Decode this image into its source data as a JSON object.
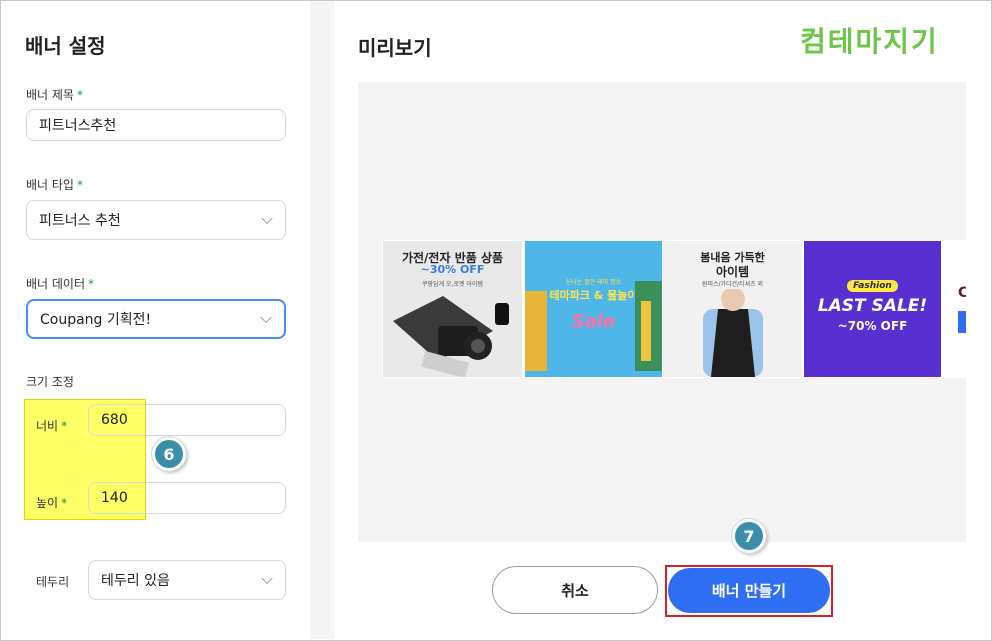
{
  "left": {
    "title": "배너 설정",
    "banner_name": {
      "label": "배너 제목",
      "value": "피트너스추천"
    },
    "banner_type": {
      "label": "배너 타입",
      "value": "피트너스 추천"
    },
    "banner_data": {
      "label": "배너 데이터",
      "value": "Coupang 기획전!"
    },
    "resize": {
      "label": "크기 조정",
      "width_label": "너비",
      "width_value": "680",
      "height_label": "높이",
      "height_value": "140"
    },
    "border": {
      "label": "테두리",
      "value": "테두리 있음"
    },
    "required_mark": "*",
    "step_badge": "6"
  },
  "right": {
    "title": "미리보기",
    "logo": "컴테마지기",
    "step_badge": "7",
    "banners": [
      {
        "headline": "가전/전자 반품 상품",
        "sub": "~30% OFF",
        "note": "쿠팡답게 오,로켓 아이템"
      },
      {
        "headline": "테마파크 & 물놀이",
        "sub": "Sale",
        "note": "신나는 할인 테마 명소"
      },
      {
        "headline": "봄내음 가득한",
        "sub": "아이템",
        "note": "원피스/가디건/티셔츠 외"
      },
      {
        "headline": "LAST SALE!",
        "sub": "~70% OFF",
        "note": "Fashion"
      }
    ],
    "cancel_label": "취소",
    "create_label": "배너 만들기"
  },
  "colors": {
    "accent": "#2f6df2",
    "badge": "#3a8ea8",
    "highlight": "#ffff00",
    "callout": "#d9202a",
    "logo": "#6cc64a"
  }
}
